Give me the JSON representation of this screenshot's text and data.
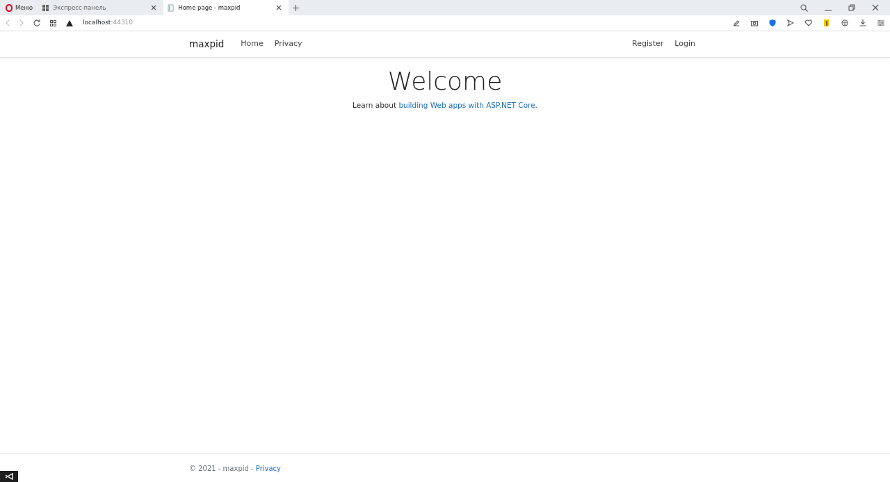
{
  "browser": {
    "menu_label": "Меню",
    "tabs": [
      {
        "title": "Экспресс-панель",
        "selected": false
      },
      {
        "title": "Home page - maxpid",
        "selected": true
      }
    ],
    "url_host": "localhost",
    "url_port": ":44310"
  },
  "navbar": {
    "brand": "maxpid",
    "links": [
      {
        "label": "Home"
      },
      {
        "label": "Privacy"
      }
    ],
    "account_links": [
      {
        "label": "Register"
      },
      {
        "label": "Login"
      }
    ]
  },
  "hero": {
    "heading": "Welcome",
    "lead_prefix": "Learn about ",
    "lead_link": "building Web apps with ASP.NET Core",
    "lead_suffix": "."
  },
  "footer": {
    "text": "© 2021 - maxpid - ",
    "link": "Privacy"
  }
}
